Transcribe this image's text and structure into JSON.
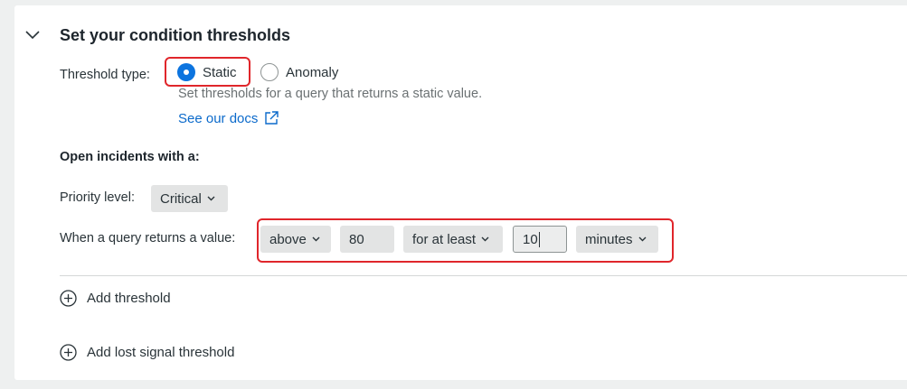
{
  "section": {
    "title": "Set your condition thresholds"
  },
  "threshold_type": {
    "label": "Threshold type:",
    "options": [
      {
        "label": "Static",
        "selected": true
      },
      {
        "label": "Anomaly",
        "selected": false
      }
    ],
    "description": "Set thresholds for a query that returns a static value.",
    "docs_link": "See our docs"
  },
  "incidents": {
    "heading": "Open incidents with a:",
    "priority_label": "Priority level:",
    "priority_value": "Critical",
    "query_label": "When a query returns a value:",
    "operator": "above",
    "threshold_value": "80",
    "duration_mode": "for at least",
    "duration_value": "10",
    "duration_unit": "minutes"
  },
  "actions": {
    "add_threshold": "Add threshold",
    "add_lost_signal": "Add lost signal threshold"
  },
  "colors": {
    "accent": "#0c74df",
    "link": "#0b6acb",
    "highlight": "#e0262b"
  }
}
